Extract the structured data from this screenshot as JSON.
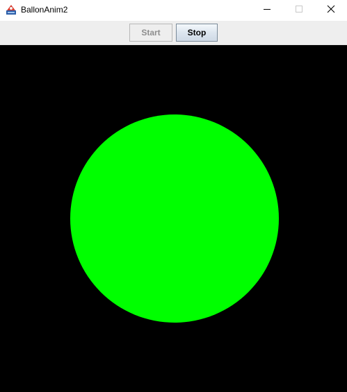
{
  "window": {
    "title": "BallonAnim2",
    "icon": "java-app-icon",
    "controls": {
      "minimize_icon": "minimize-icon",
      "maximize_icon": "maximize-icon",
      "close_icon": "close-icon"
    }
  },
  "toolbar": {
    "start_label": "Start",
    "stop_label": "Stop",
    "start_enabled": false,
    "stop_enabled": true
  },
  "canvas": {
    "background_color": "#000000",
    "ball_color": "#00ff00"
  }
}
